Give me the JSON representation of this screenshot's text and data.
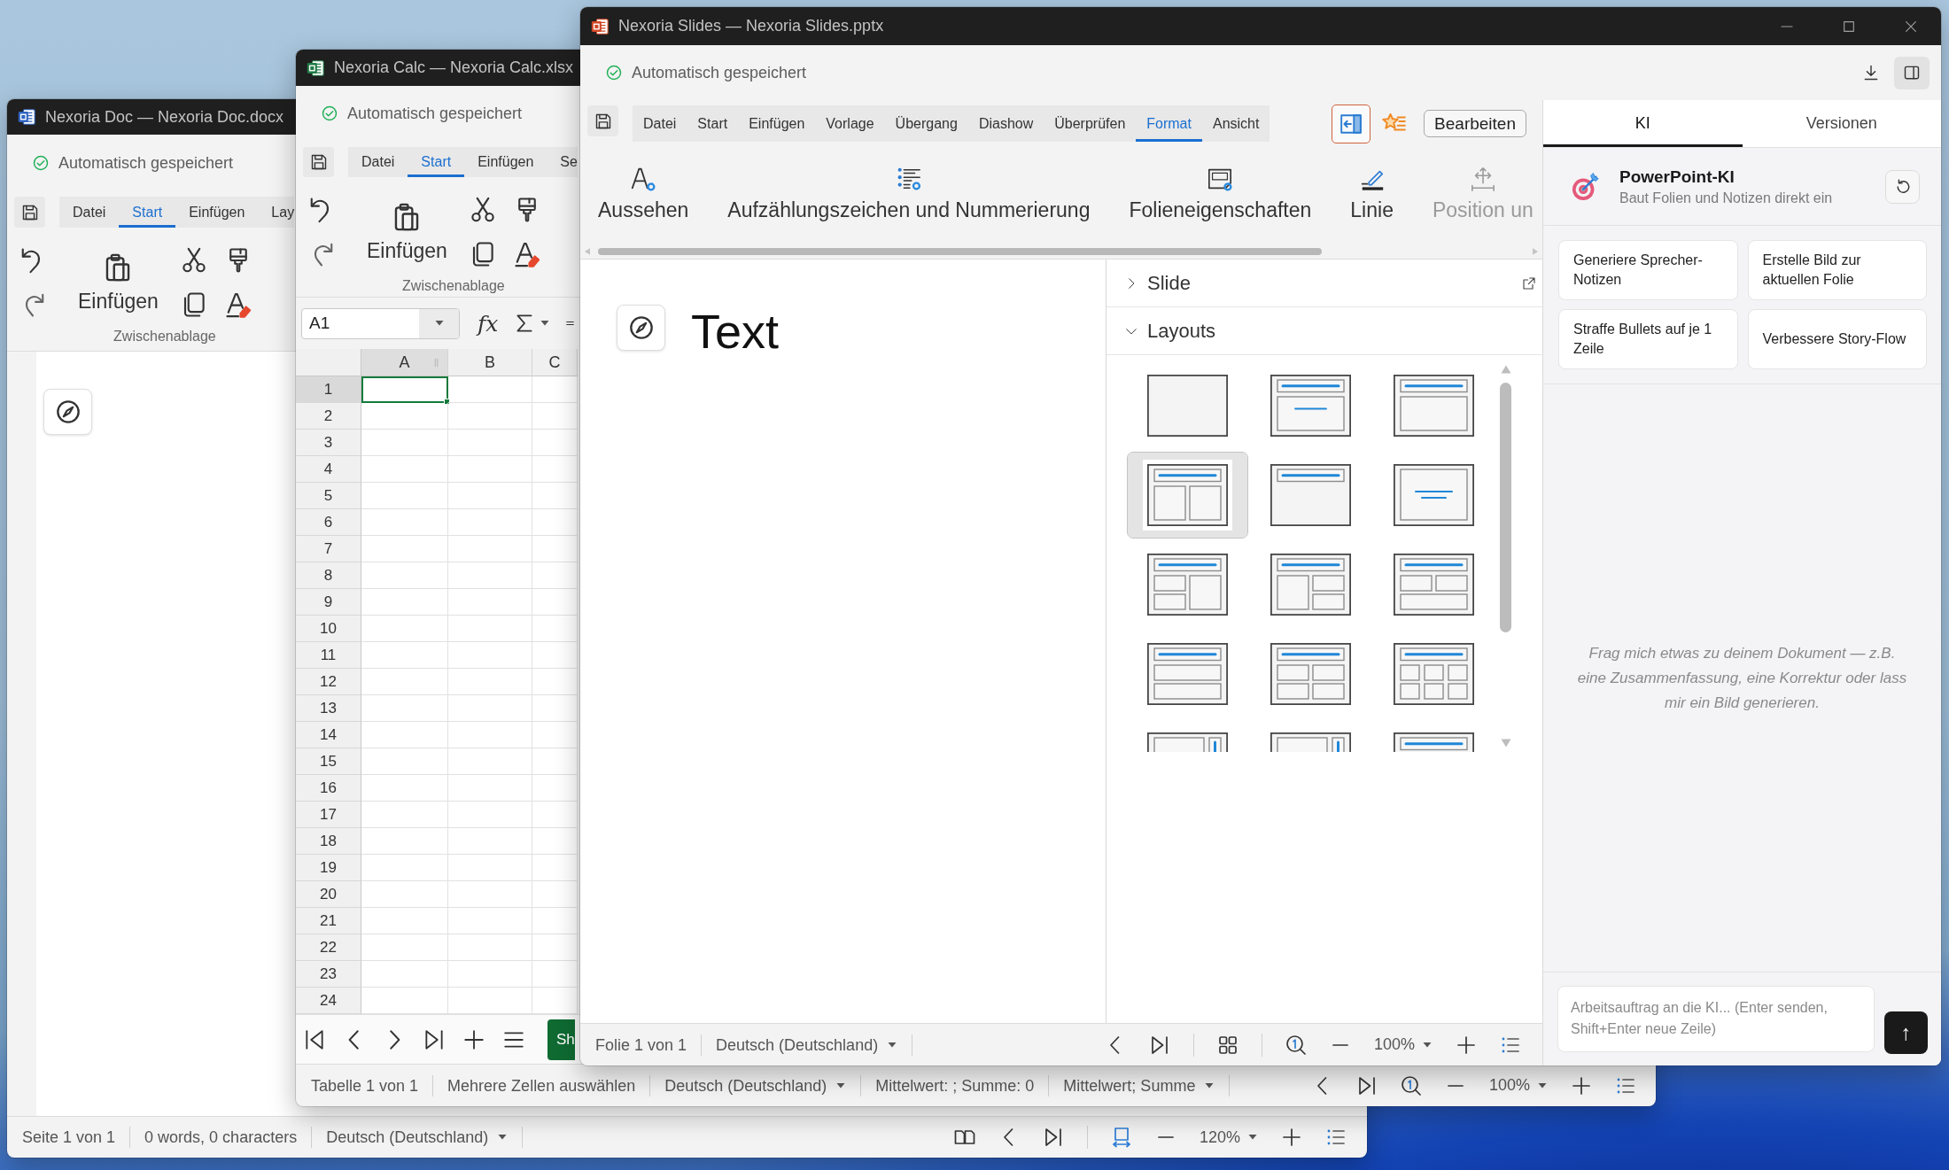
{
  "doc_window": {
    "title": "Nexoria Doc — Nexoria Doc.docx",
    "autosave": "Automatisch gespeichert",
    "tabs": [
      {
        "label": "Datei",
        "selected": false
      },
      {
        "label": "Start",
        "selected": true
      },
      {
        "label": "Einfügen",
        "selected": false
      },
      {
        "label": "Lay",
        "selected": false
      }
    ],
    "clipboard": {
      "paste": "Einfügen",
      "group": "Zwischenablage"
    },
    "status_bar": {
      "page": "Seite 1 von 1",
      "words": "0 words, 0 characters",
      "language": "Deutsch (Deutschland)",
      "zoom": "120%"
    }
  },
  "calc_window": {
    "title": "Nexoria Calc — Nexoria Calc.xlsx",
    "autosave": "Automatisch gespeichert",
    "tabs": [
      {
        "label": "Datei",
        "selected": false
      },
      {
        "label": "Start",
        "selected": true
      },
      {
        "label": "Einfügen",
        "selected": false
      },
      {
        "label": "Se",
        "selected": false
      }
    ],
    "clipboard": {
      "paste": "Einfügen",
      "group": "Zwischenablage"
    },
    "name_box": "A1",
    "function_button": "fx",
    "columns": [
      {
        "label": "A",
        "selected": true
      },
      {
        "label": "B",
        "selected": false
      },
      {
        "label": "C",
        "selected": false
      }
    ],
    "rows": [
      {
        "label": "1",
        "selected": true
      },
      {
        "label": "2",
        "selected": false
      },
      {
        "label": "3",
        "selected": false
      },
      {
        "label": "4",
        "selected": false
      },
      {
        "label": "5",
        "selected": false
      },
      {
        "label": "6",
        "selected": false
      },
      {
        "label": "7",
        "selected": false
      },
      {
        "label": "8",
        "selected": false
      },
      {
        "label": "9",
        "selected": false
      },
      {
        "label": "10",
        "selected": false
      },
      {
        "label": "11",
        "selected": false
      },
      {
        "label": "12",
        "selected": false
      },
      {
        "label": "13",
        "selected": false
      },
      {
        "label": "14",
        "selected": false
      },
      {
        "label": "15",
        "selected": false
      },
      {
        "label": "16",
        "selected": false
      },
      {
        "label": "17",
        "selected": false
      },
      {
        "label": "18",
        "selected": false
      },
      {
        "label": "19",
        "selected": false
      },
      {
        "label": "20",
        "selected": false
      },
      {
        "label": "21",
        "selected": false
      },
      {
        "label": "22",
        "selected": false
      },
      {
        "label": "23",
        "selected": false
      },
      {
        "label": "24",
        "selected": false
      }
    ],
    "sheet_tab": "Sh",
    "status_bar": {
      "sheet": "Tabelle 1 von 1",
      "mode": "Mehrere Zellen auswählen",
      "language": "Deutsch (Deutschland)",
      "stats": "Mittelwert: ; Summe: 0",
      "stats_menu": "Mittelwert; Summe",
      "zoom": "100%"
    }
  },
  "slides_window": {
    "title": "Nexoria Slides — Nexoria Slides.pptx",
    "autosave": "Automatisch gespeichert",
    "panel_button": {
      "selected": true
    },
    "tabs": [
      {
        "label": "Datei",
        "selected": false
      },
      {
        "label": "Start",
        "selected": false
      },
      {
        "label": "Einfügen",
        "selected": false
      },
      {
        "label": "Vorlage",
        "selected": false
      },
      {
        "label": "Übergang",
        "selected": false
      },
      {
        "label": "Diashow",
        "selected": false
      },
      {
        "label": "Überprüfen",
        "selected": false
      },
      {
        "label": "Format",
        "selected": true
      },
      {
        "label": "Ansicht",
        "selected": false
      }
    ],
    "sidebar_button": {
      "highlighted": true
    },
    "edit_button": "Bearbeiten",
    "ribbon": [
      {
        "kind": "appearance",
        "label": "Aussehen",
        "disabled": false
      },
      {
        "kind": "bullets",
        "label": "Aufzählungszeichen und Nummerierung",
        "disabled": false
      },
      {
        "kind": "slide-properties",
        "label": "Folieneigenschaften",
        "disabled": false
      },
      {
        "kind": "line",
        "label": "Linie",
        "disabled": false
      },
      {
        "kind": "position",
        "label": "Position un",
        "disabled": true
      }
    ],
    "slide": {
      "text": "Text"
    },
    "side_panel": {
      "sections": [
        {
          "label": "Slide",
          "expanded": false,
          "popout": true
        },
        {
          "label": "Layouts",
          "expanded": true,
          "popout": false,
          "layouts": [
            {
              "kind": "blank",
              "selected": false
            },
            {
              "kind": "title-content-line",
              "selected": false
            },
            {
              "kind": "title-content",
              "selected": false
            },
            {
              "kind": "two-content",
              "selected": true
            },
            {
              "kind": "title-only",
              "selected": false
            },
            {
              "kind": "section",
              "selected": false
            },
            {
              "kind": "left-stacked",
              "selected": false
            },
            {
              "kind": "right-stacked",
              "selected": false
            },
            {
              "kind": "top-pair",
              "selected": false
            },
            {
              "kind": "two-rows",
              "selected": false
            },
            {
              "kind": "grid-2x2",
              "selected": false
            },
            {
              "kind": "grid-3x2",
              "selected": false
            },
            {
              "kind": "content-sidebar",
              "selected": false
            },
            {
              "kind": "content-sidebar",
              "selected": false
            },
            {
              "kind": "title-content",
              "selected": false
            }
          ]
        }
      ]
    },
    "status_bar": {
      "slide": "Folie 1 von 1",
      "language": "Deutsch (Deutschland)",
      "zoom": "100%"
    },
    "ai_panel": {
      "tabs": [
        {
          "label": "KI",
          "selected": true
        },
        {
          "label": "Versionen",
          "selected": false
        }
      ],
      "title": "PowerPoint-KI",
      "subtitle": "Baut Folien und Notizen direkt ein",
      "suggestions": [
        "Generiere Sprecher-Notizen",
        "Erstelle Bild zur aktuellen Folie",
        "Straffe Bullets auf je 1 Zeile",
        "Verbessere Story-Flow"
      ],
      "hint": "Frag mich etwas zu deinem Dokument — z.B. eine Zusammenfassung, eine Korrektur oder lass mir ein Bild generieren.",
      "input": {
        "placeholder": "Arbeitsauftrag an die KI... (Enter senden, Shift+Enter neue Zeile)"
      },
      "send": "↑"
    }
  }
}
